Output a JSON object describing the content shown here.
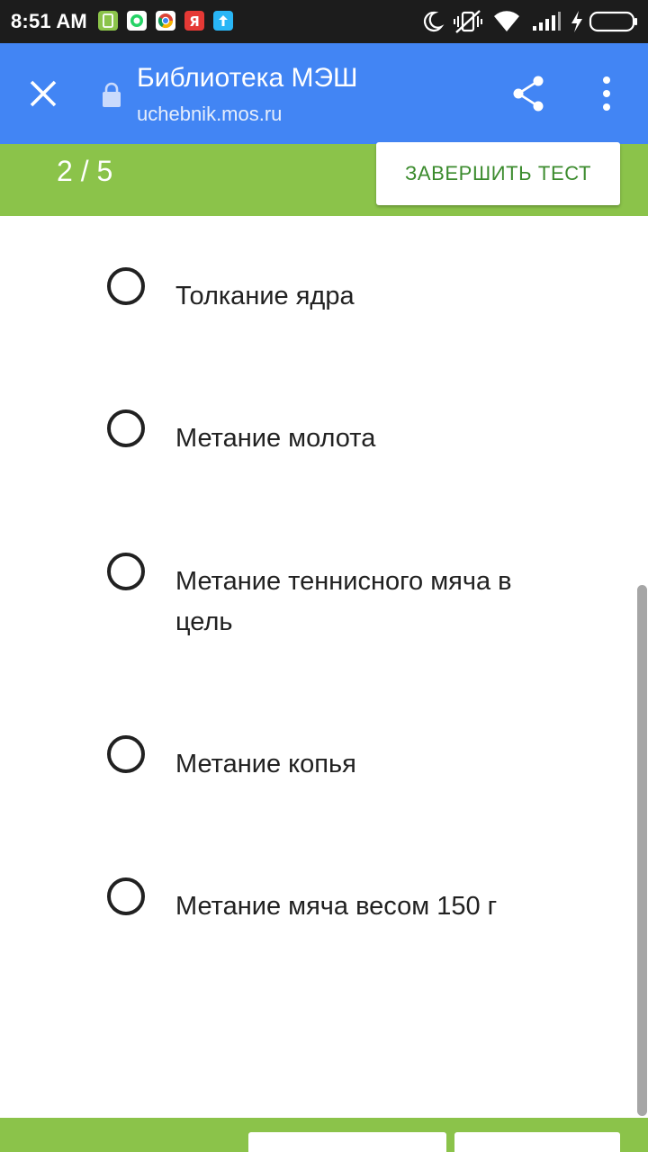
{
  "status_bar": {
    "time": "8:51 AM",
    "icons": [
      "sim-card-icon",
      "whatsapp-icon",
      "chrome-icon",
      "yandex-icon",
      "upload-icon",
      "moon-icon",
      "vibrate-off-icon",
      "wifi-icon",
      "signal-icon",
      "charging-icon",
      "battery-icon"
    ]
  },
  "browser": {
    "title": "Библиотека МЭШ",
    "url": "uchebnik.mos.ru",
    "icons": [
      "close-icon",
      "lock-icon",
      "share-icon",
      "more-vert-icon"
    ]
  },
  "test": {
    "progress": "2 / 5",
    "finish_label": "ЗАВЕРШИТЬ ТЕСТ"
  },
  "options": [
    {
      "label": "Толкание ядра",
      "selected": false
    },
    {
      "label": "Метание молота",
      "selected": false
    },
    {
      "label": "Метание теннисного мяча в цель",
      "selected": false
    },
    {
      "label": "Метание копья",
      "selected": false
    },
    {
      "label": "Метание мяча весом 150 г",
      "selected": false
    }
  ],
  "colors": {
    "status_bar": "#1c1c1c",
    "toolbar": "#4285f4",
    "accent_green": "#8bc34a",
    "button_text_green": "#3b8b2d",
    "text": "#212121"
  }
}
